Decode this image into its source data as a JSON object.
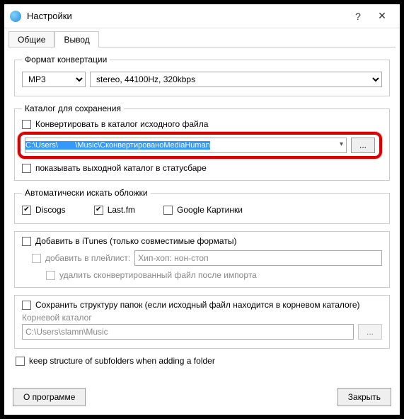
{
  "window": {
    "title": "Настройки",
    "help_icon": "?",
    "close_icon": "✕"
  },
  "tabs": {
    "general": "Общие",
    "output": "Вывод"
  },
  "format": {
    "legend": "Формат конвертации",
    "codec": "MP3",
    "params": "stereo, 44100Hz, 320kbps"
  },
  "saveDir": {
    "legend": "Каталог для сохранения",
    "convertToSource": "Конвертировать в каталог исходного файла",
    "pathParts": {
      "p1": "C:\\Users\\",
      "p2": "        ",
      "p3": "\\Music\\СконвертированоMediaHuman"
    },
    "browse": "...",
    "showInStatusbar": "показывать выходной каталог в статусбаре"
  },
  "covers": {
    "legend": "Автоматически искать обложки",
    "discogs": "Discogs",
    "lastfm": "Last.fm",
    "google": "Google Картинки"
  },
  "itunes": {
    "addToItunes": "Добавить в iTunes (только совместимые форматы)",
    "addToPlaylist": "добавить в плейлист:",
    "playlist": "Хип-хоп: нон-стоп",
    "deleteAfterImport": "удалить сконвертированный файл после импорта"
  },
  "structure": {
    "keepStructure": "Сохранить структуру папок (если исходный файл находится в корневом каталоге)",
    "rootLabel": "Корневой каталог",
    "rootPath": "C:\\Users\\slamn\\Music",
    "browse": "...",
    "keepSubfolders": "keep structure of subfolders when adding a folder"
  },
  "footer": {
    "about": "О программе",
    "close": "Закрыть"
  }
}
